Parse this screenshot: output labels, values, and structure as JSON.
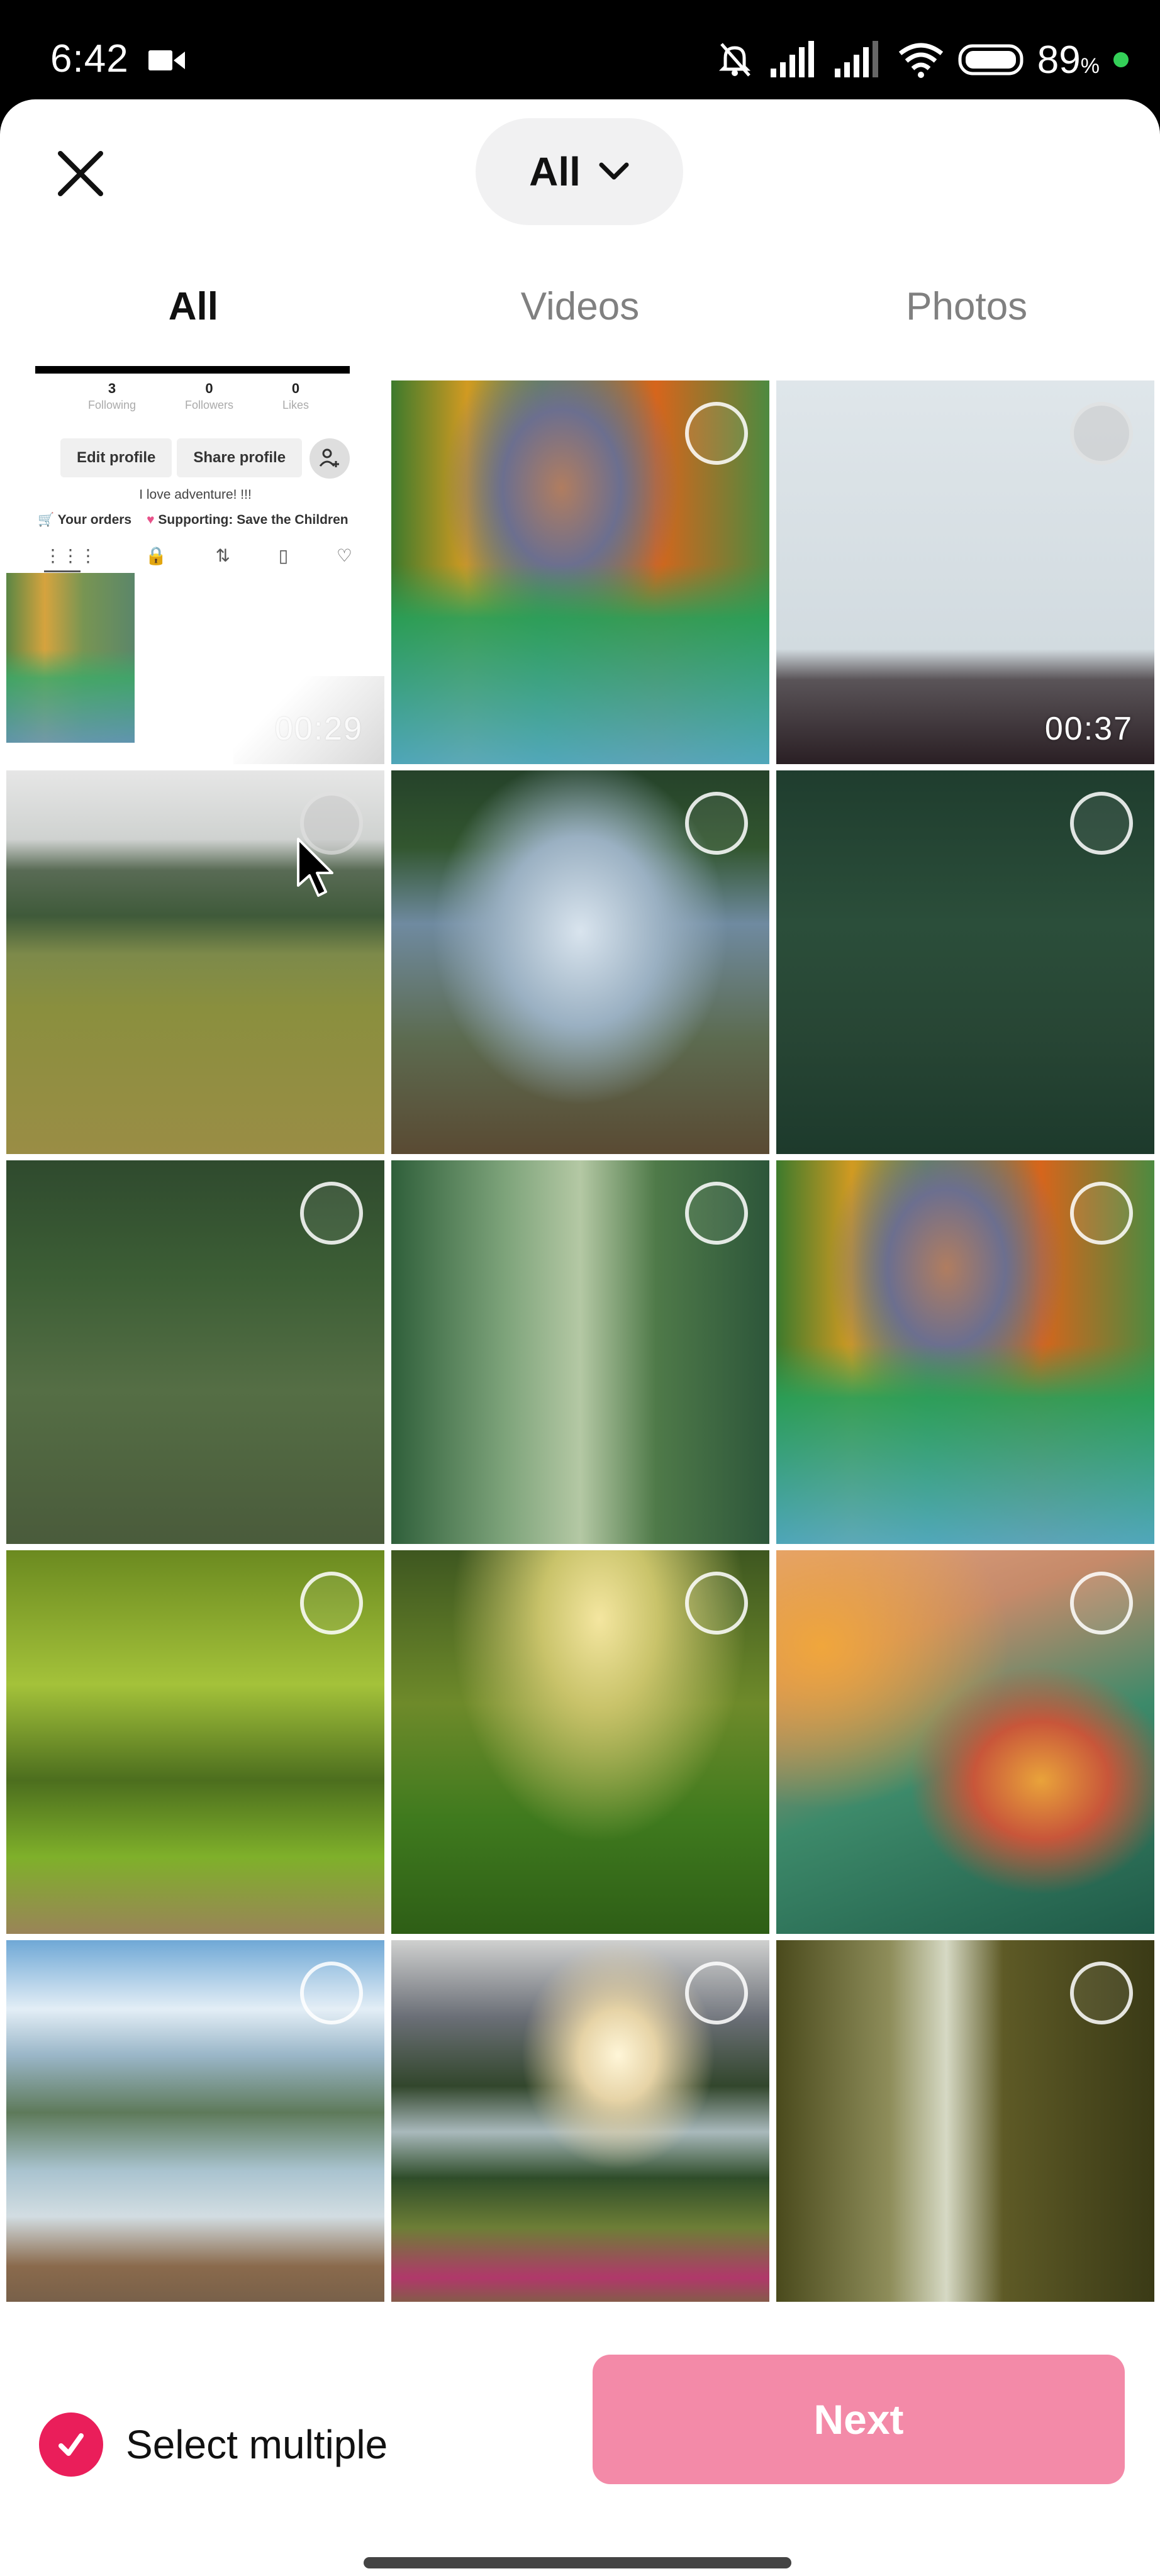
{
  "status_bar": {
    "time": "6:42",
    "battery_percent": "89",
    "battery_unit": "%",
    "icons": [
      "video-camera-icon",
      "mute-bell-icon",
      "signal-icon",
      "signal-icon",
      "wifi-icon",
      "battery-icon",
      "privacy-dot"
    ]
  },
  "header": {
    "close_icon": "close-icon",
    "album_selector": {
      "label": "All",
      "icon": "chevron-down-icon"
    }
  },
  "tabs": [
    {
      "label": "All",
      "active": true
    },
    {
      "label": "Videos",
      "active": false
    },
    {
      "label": "Photos",
      "active": false
    }
  ],
  "grid": {
    "items": [
      {
        "type": "video",
        "description": "profile-screenshot",
        "duration": "00:29"
      },
      {
        "type": "photo",
        "description": "mountain-lake-autumn"
      },
      {
        "type": "video",
        "description": "suspension-bridge-drive",
        "duration": "00:37"
      },
      {
        "type": "photo",
        "description": "hiker-meadow-mountains"
      },
      {
        "type": "photo",
        "description": "hiker-waterfall-arms-raised"
      },
      {
        "type": "photo",
        "description": "hiker-dark-forest"
      },
      {
        "type": "photo",
        "description": "hiker-rope-bridge"
      },
      {
        "type": "photo",
        "description": "hiker-forest-path"
      },
      {
        "type": "photo",
        "description": "mountain-lake-autumn"
      },
      {
        "type": "photo",
        "description": "park-path-bench"
      },
      {
        "type": "photo",
        "description": "sunlit-forest-path"
      },
      {
        "type": "photo",
        "description": "butterfly-flower"
      },
      {
        "type": "photo",
        "description": "lake-dock-mountains"
      },
      {
        "type": "photo",
        "description": "sunset-mountain-lake-flowers"
      },
      {
        "type": "photo",
        "description": "tall-forest-trail"
      }
    ]
  },
  "profile_screenshot": {
    "stats": [
      {
        "value": "3",
        "label": "Following"
      },
      {
        "value": "0",
        "label": "Followers"
      },
      {
        "value": "0",
        "label": "Likes"
      }
    ],
    "edit_profile": "Edit profile",
    "share_profile": "Share profile",
    "bio": "I love adventure! !!!",
    "orders": "Your orders",
    "supporting": "Supporting: Save the Children"
  },
  "bottom_bar": {
    "select_multiple_label": "Select multiple",
    "select_multiple_checked": true,
    "next_label": "Next"
  },
  "colors": {
    "accent": "#ea1e5a",
    "next_button_disabled": "#f38aa8",
    "tab_inactive": "#808080"
  }
}
